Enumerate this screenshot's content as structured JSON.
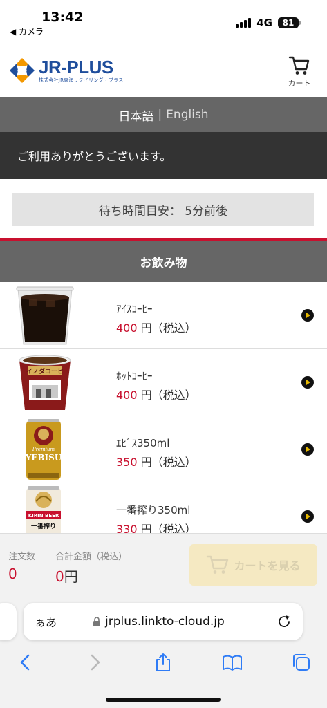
{
  "status": {
    "time": "13:42",
    "back_app": "◀ カメラ",
    "network": "4G",
    "battery": "81"
  },
  "header": {
    "logo_name": "JR-PLUS",
    "logo_sub": "株式会社JR東海リテイリング・プラス",
    "cart_label": "カート"
  },
  "lang": {
    "japanese": "日本語",
    "separator": "|",
    "english": "English"
  },
  "thanks": "ご利用ありがとうございます。",
  "wait": "待ち時間目安： 5分前後",
  "category": "お飲み物",
  "products": [
    {
      "name": "ｱｲｽｺｰﾋｰ",
      "price": "400",
      "unit": "円（税込）"
    },
    {
      "name": "ﾎｯﾄｺｰﾋｰ",
      "price": "400",
      "unit": "円（税込）"
    },
    {
      "name": "ｴﾋﾞｽ350ml",
      "price": "350",
      "unit": "円（税込）"
    },
    {
      "name": "一番搾り350ml",
      "price": "330",
      "unit": "円（税込）"
    }
  ],
  "product_labels": {
    "hot_cup_brand": "イノダコーヒ",
    "yebisu_brand": "YEBISU",
    "yebisu_premium": "Premium",
    "kirin_brand": "KIRIN BEER",
    "kirin_sub": "一番搾り"
  },
  "footer": {
    "order_count_label": "注文数",
    "order_count": "0",
    "total_label": "合計金額（税込）",
    "total_value": "0",
    "total_unit": "円",
    "cart_button": "カートを見る"
  },
  "browser": {
    "aa": "ぁあ",
    "url": "jrplus.linkto-cloud.jp"
  },
  "colors": {
    "accent_red": "#c8102e",
    "brand_blue": "#1f4e9c",
    "toolbar_blue": "#2f7cf6"
  }
}
